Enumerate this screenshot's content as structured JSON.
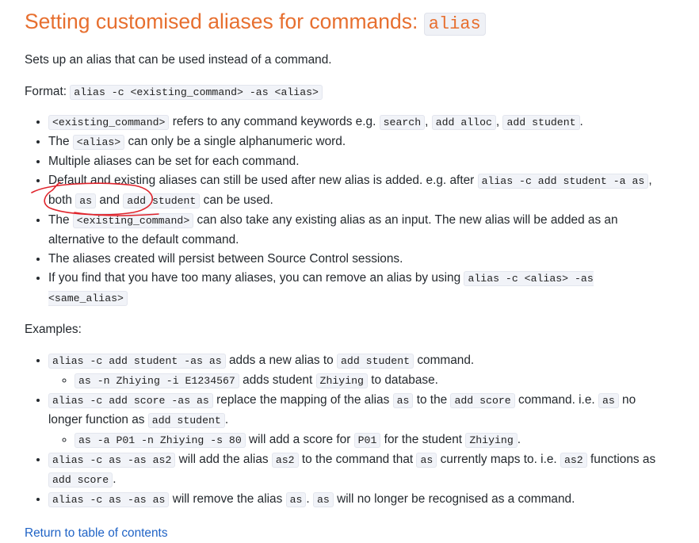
{
  "heading": {
    "text": "Setting customised aliases for commands: ",
    "code": "alias"
  },
  "intro": "Sets up an alias that can be used instead of a command.",
  "format": {
    "label": "Format: ",
    "code": "alias -c <existing_command> -as <alias>"
  },
  "notes": [
    {
      "parts": [
        {
          "c": "<existing_command>"
        },
        {
          "t": " refers to any command keywords e.g. "
        },
        {
          "c": "search"
        },
        {
          "t": ", "
        },
        {
          "c": "add alloc"
        },
        {
          "t": ", "
        },
        {
          "c": "add student"
        },
        {
          "t": "."
        }
      ]
    },
    {
      "parts": [
        {
          "t": "The "
        },
        {
          "c": "<alias>"
        },
        {
          "t": " can only be a single alphanumeric word."
        }
      ]
    },
    {
      "parts": [
        {
          "t": "Multiple aliases can be set for each command."
        }
      ]
    },
    {
      "parts": [
        {
          "t": "Default and existing aliases can still be used after new alias is added. e.g. after "
        },
        {
          "c": "alias -c add student -a as"
        },
        {
          "t": ", both "
        },
        {
          "c": "as"
        },
        {
          "t": " and "
        },
        {
          "c": "add student"
        },
        {
          "t": " can be used."
        }
      ]
    },
    {
      "parts": [
        {
          "t": "The "
        },
        {
          "c": "<existing_command>"
        },
        {
          "t": " can also take any existing alias as an input. The new alias will be added as an alternative to the default command."
        }
      ]
    },
    {
      "parts": [
        {
          "t": "The aliases created will persist between Source Control sessions."
        }
      ]
    },
    {
      "parts": [
        {
          "t": "If you find that you have too many aliases, you can remove an alias by using "
        },
        {
          "c": "alias -c <alias> -as <same_alias>"
        }
      ]
    }
  ],
  "examples_label": "Examples:",
  "examples": [
    {
      "parts": [
        {
          "c": "alias -c add student -as as"
        },
        {
          "t": " adds a new alias to "
        },
        {
          "c": "add student"
        },
        {
          "t": " command."
        }
      ],
      "sub": [
        {
          "parts": [
            {
              "c": "as -n Zhiying -i E1234567"
            },
            {
              "t": " adds student "
            },
            {
              "c": "Zhiying"
            },
            {
              "t": " to database."
            }
          ]
        }
      ]
    },
    {
      "parts": [
        {
          "c": "alias -c add score -as as"
        },
        {
          "t": " replace the mapping of the alias "
        },
        {
          "c": "as"
        },
        {
          "t": " to the "
        },
        {
          "c": "add score"
        },
        {
          "t": " command. i.e. "
        },
        {
          "c": "as"
        },
        {
          "t": " no longer function as "
        },
        {
          "c": "add student"
        },
        {
          "t": "."
        }
      ],
      "sub": [
        {
          "parts": [
            {
              "c": "as -a P01 -n Zhiying -s 80"
            },
            {
              "t": " will add a score for "
            },
            {
              "c": "P01"
            },
            {
              "t": " for the student "
            },
            {
              "c": "Zhiying"
            },
            {
              "t": "."
            }
          ]
        }
      ]
    },
    {
      "parts": [
        {
          "c": "alias -c as -as as2"
        },
        {
          "t": " will add the alias "
        },
        {
          "c": "as2"
        },
        {
          "t": " to the command that "
        },
        {
          "c": "as"
        },
        {
          "t": " currently maps to. i.e. "
        },
        {
          "c": "as2"
        },
        {
          "t": " functions as "
        },
        {
          "c": "add score"
        },
        {
          "t": "."
        }
      ]
    },
    {
      "parts": [
        {
          "c": "alias -c as -as as"
        },
        {
          "t": " will remove the alias "
        },
        {
          "c": "as"
        },
        {
          "t": ". "
        },
        {
          "c": "as"
        },
        {
          "t": " will no longer be recognised as a command."
        }
      ]
    }
  ],
  "toc_link": "Return to table of contents",
  "colors": {
    "heading": "#e76f2f",
    "link": "#1f63c6",
    "annotation": "#e0242c"
  }
}
